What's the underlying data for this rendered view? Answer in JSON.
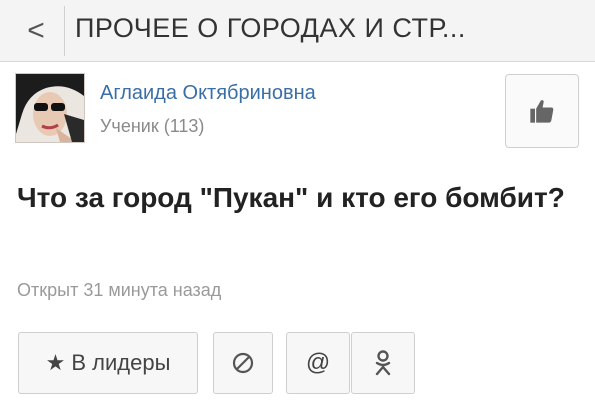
{
  "header": {
    "back_glyph": "<",
    "title": "ПРОЧЕЕ О ГОРОДАХ И СТР..."
  },
  "author": {
    "name": "Аглаида Октябриновна",
    "role": "Ученик (113)"
  },
  "question": {
    "text": "Что за город \"Пукан\" и кто его бомбит?",
    "opened": "Открыт 31 минута назад"
  },
  "actions": {
    "leaders_label": "В лидеры",
    "leaders_icon": "star-icon",
    "block_icon": "block-icon",
    "at_glyph": "@",
    "ok_icon": "odnoklassniki-icon",
    "like_icon": "thumbs-up-icon"
  }
}
